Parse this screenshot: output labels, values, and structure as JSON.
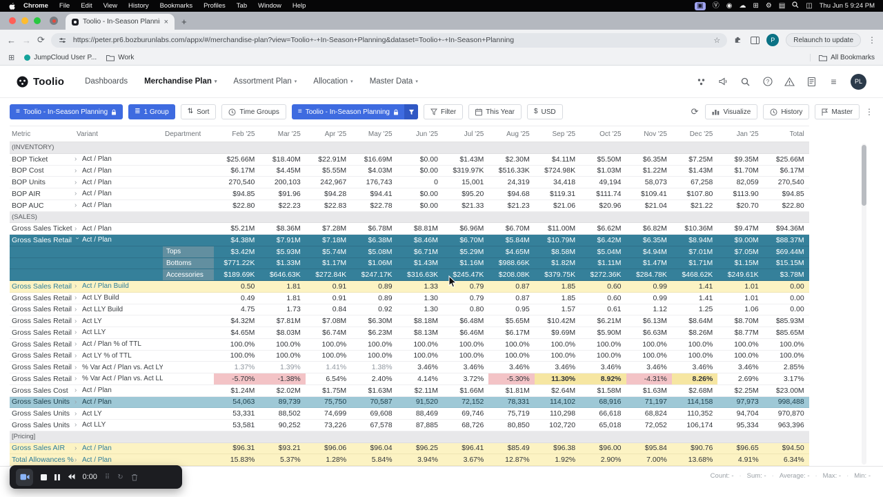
{
  "window": {
    "clock": "Thu Jun 5 9:24 PM",
    "menu_items": [
      "Chrome",
      "File",
      "Edit",
      "View",
      "History",
      "Bookmarks",
      "Profiles",
      "Tab",
      "Window",
      "Help"
    ]
  },
  "browser": {
    "tab_title": "Toolio - In-Season Planning",
    "url": "https://peter.pr6.bozburunlabs.com/appx/#/merchandise-plan?view=Toolio+-+In-Season+Planning&dataset=Toolio+-+In-Season+Planning",
    "relaunch_label": "Relaunch to update",
    "bookmarks": [
      "JumpCloud User P...",
      "Work"
    ],
    "all_bookmarks_label": "All Bookmarks"
  },
  "header": {
    "logo": "Toolio",
    "nav": [
      {
        "label": "Dashboards",
        "caret": false,
        "active": false
      },
      {
        "label": "Merchandise Plan",
        "caret": true,
        "active": true
      },
      {
        "label": "Assortment Plan",
        "caret": true,
        "active": false
      },
      {
        "label": "Allocation",
        "caret": true,
        "active": false
      },
      {
        "label": "Master Data",
        "caret": true,
        "active": false
      }
    ],
    "avatar": "PL"
  },
  "toolbar": {
    "view_name": "Toolio - In-Season Planning",
    "group_label": "1 Group",
    "sort_label": "Sort",
    "time_groups_label": "Time Groups",
    "filter_label": "Filter",
    "this_year_label": "This Year",
    "currency_label": "USD",
    "visualize_label": "Visualize",
    "history_label": "History",
    "master_label": "Master"
  },
  "table": {
    "columns": [
      "Metric",
      "Variant",
      "Department",
      "Feb '25",
      "Mar '25",
      "Apr '25",
      "May '25",
      "Jun '25",
      "Jul '25",
      "Aug '25",
      "Sep '25",
      "Oct '25",
      "Nov '25",
      "Dec '25",
      "Jan '25",
      "Total"
    ],
    "rows": [
      {
        "type": "section",
        "label": "(INVENTORY)"
      },
      {
        "type": "data",
        "metric": "BOP Ticket",
        "variant": "Act / Plan",
        "department": "",
        "style": "",
        "values": [
          "$25.66M",
          "$18.40M",
          "$22.91M",
          "$16.69M",
          "$0.00",
          "$1.43M",
          "$2.30M",
          "$4.11M",
          "$5.50M",
          "$6.35M",
          "$7.25M",
          "$9.35M",
          "$25.66M"
        ]
      },
      {
        "type": "data",
        "metric": "BOP Cost",
        "variant": "Act / Plan",
        "department": "",
        "style": "",
        "values": [
          "$6.17M",
          "$4.45M",
          "$5.55M",
          "$4.03M",
          "$0.00",
          "$319.97K",
          "$516.33K",
          "$724.98K",
          "$1.03M",
          "$1.22M",
          "$1.43M",
          "$1.70M",
          "$6.17M"
        ]
      },
      {
        "type": "data",
        "metric": "BOP Units",
        "variant": "Act / Plan",
        "department": "",
        "style": "",
        "values": [
          "270,540",
          "200,103",
          "242,967",
          "176,743",
          "0",
          "15,001",
          "24,319",
          "34,418",
          "49,194",
          "58,073",
          "67,258",
          "82,059",
          "270,540"
        ]
      },
      {
        "type": "data",
        "metric": "BOP AIR",
        "variant": "Act / Plan",
        "department": "",
        "style": "",
        "values": [
          "$94.85",
          "$91.96",
          "$94.28",
          "$94.41",
          "$0.00",
          "$95.20",
          "$94.68",
          "$119.31",
          "$111.74",
          "$109.41",
          "$107.80",
          "$113.90",
          "$94.85"
        ]
      },
      {
        "type": "data",
        "metric": "BOP AUC",
        "variant": "Act / Plan",
        "department": "",
        "style": "",
        "values": [
          "$22.80",
          "$22.23",
          "$22.83",
          "$22.78",
          "$0.00",
          "$21.33",
          "$21.23",
          "$21.06",
          "$20.96",
          "$21.04",
          "$21.22",
          "$20.70",
          "$22.80"
        ]
      },
      {
        "type": "section",
        "label": "(SALES)"
      },
      {
        "type": "data",
        "metric": "Gross Sales Ticket",
        "variant": "Act / Plan",
        "department": "",
        "style": "",
        "values": [
          "$5.21M",
          "$8.36M",
          "$7.28M",
          "$6.78M",
          "$8.81M",
          "$6.96M",
          "$6.70M",
          "$11.00M",
          "$6.62M",
          "$6.82M",
          "$10.36M",
          "$9.47M",
          "$94.36M"
        ]
      },
      {
        "type": "data",
        "metric": "Gross Sales Retail",
        "variant": "Act / Plan",
        "department": "",
        "style": "selected",
        "expanded": true,
        "values": [
          "$4.38M",
          "$7.91M",
          "$7.18M",
          "$6.38M",
          "$8.46M",
          "$6.70M",
          "$5.84M",
          "$10.79M",
          "$6.42M",
          "$6.35M",
          "$8.94M",
          "$9.00M",
          "$88.37M"
        ]
      },
      {
        "type": "data",
        "metric": "",
        "variant": "",
        "department": "Tops",
        "style": "sub",
        "values": [
          "$3.42M",
          "$5.93M",
          "$5.74M",
          "$5.08M",
          "$6.71M",
          "$5.29M",
          "$4.65M",
          "$8.58M",
          "$5.04M",
          "$4.94M",
          "$7.01M",
          "$7.05M",
          "$69.44M"
        ]
      },
      {
        "type": "data",
        "metric": "",
        "variant": "",
        "department": "Bottoms",
        "style": "sub",
        "values": [
          "$771.22K",
          "$1.33M",
          "$1.17M",
          "$1.06M",
          "$1.43M",
          "$1.16M",
          "$988.66K",
          "$1.82M",
          "$1.11M",
          "$1.47M",
          "$1.71M",
          "$1.15M",
          "$15.15M"
        ]
      },
      {
        "type": "data",
        "metric": "",
        "variant": "",
        "department": "Accessories",
        "style": "sub",
        "values": [
          "$189.69K",
          "$646.63K",
          "$272.84K",
          "$247.17K",
          "$316.63K",
          "$245.47K",
          "$208.08K",
          "$379.75K",
          "$272.36K",
          "$284.78K",
          "$468.62K",
          "$249.61K",
          "$3.78M"
        ]
      },
      {
        "type": "data",
        "metric": "Gross Sales Retail",
        "variant": "Act / Plan Build",
        "department": "",
        "style": "yellow",
        "values": [
          "0.50",
          "1.81",
          "0.91",
          "0.89",
          "1.33",
          "0.79",
          "0.87",
          "1.85",
          "0.60",
          "0.99",
          "1.41",
          "1.01",
          "0.00"
        ]
      },
      {
        "type": "data",
        "metric": "Gross Sales Retail",
        "variant": "Act LY Build",
        "department": "",
        "style": "",
        "values": [
          "0.49",
          "1.81",
          "0.91",
          "0.89",
          "1.30",
          "0.79",
          "0.87",
          "1.85",
          "0.60",
          "0.99",
          "1.41",
          "1.01",
          "0.00"
        ]
      },
      {
        "type": "data",
        "metric": "Gross Sales Retail",
        "variant": "Act LLY Build",
        "department": "",
        "style": "",
        "values": [
          "4.75",
          "1.73",
          "0.84",
          "0.92",
          "1.30",
          "0.80",
          "0.95",
          "1.57",
          "0.61",
          "1.12",
          "1.25",
          "1.06",
          "0.00"
        ]
      },
      {
        "type": "data",
        "metric": "Gross Sales Retail",
        "variant": "Act LY",
        "department": "",
        "style": "",
        "values": [
          "$4.32M",
          "$7.81M",
          "$7.08M",
          "$6.30M",
          "$8.18M",
          "$6.48M",
          "$5.65M",
          "$10.42M",
          "$6.21M",
          "$6.13M",
          "$8.64M",
          "$8.70M",
          "$85.93M"
        ]
      },
      {
        "type": "data",
        "metric": "Gross Sales Retail",
        "variant": "Act LLY",
        "department": "",
        "style": "",
        "values": [
          "$4.65M",
          "$8.03M",
          "$6.74M",
          "$6.23M",
          "$8.13M",
          "$6.46M",
          "$6.17M",
          "$9.69M",
          "$5.90M",
          "$6.63M",
          "$8.26M",
          "$8.77M",
          "$85.65M"
        ]
      },
      {
        "type": "data",
        "metric": "Gross Sales Retail",
        "variant": "Act / Plan % of TTL",
        "department": "",
        "style": "",
        "values": [
          "100.0%",
          "100.0%",
          "100.0%",
          "100.0%",
          "100.0%",
          "100.0%",
          "100.0%",
          "100.0%",
          "100.0%",
          "100.0%",
          "100.0%",
          "100.0%",
          "100.0%"
        ]
      },
      {
        "type": "data",
        "metric": "Gross Sales Retail",
        "variant": "Act LY % of TTL",
        "department": "",
        "style": "",
        "values": [
          "100.0%",
          "100.0%",
          "100.0%",
          "100.0%",
          "100.0%",
          "100.0%",
          "100.0%",
          "100.0%",
          "100.0%",
          "100.0%",
          "100.0%",
          "100.0%",
          "100.0%"
        ]
      },
      {
        "type": "data",
        "metric": "Gross Sales Retail",
        "variant": "% Var Act / Plan vs. Act LY",
        "department": "",
        "style": "",
        "cell_styles": [
          "dim",
          "dim",
          "dim",
          "dim",
          "",
          "",
          "",
          "",
          "",
          "",
          "",
          "",
          ""
        ],
        "values": [
          "1.37%",
          "1.39%",
          "1.41%",
          "1.38%",
          "3.46%",
          "3.46%",
          "3.46%",
          "3.46%",
          "3.46%",
          "3.46%",
          "3.46%",
          "3.46%",
          "2.85%"
        ]
      },
      {
        "type": "data",
        "metric": "Gross Sales Retail",
        "variant": "% Var Act / Plan vs. Act LLY",
        "department": "",
        "style": "",
        "cell_styles": [
          "neg",
          "neg",
          "",
          "",
          "",
          "",
          "neg",
          "hl",
          "hl",
          "neg",
          "hl",
          "",
          ""
        ],
        "values": [
          "-5.70%",
          "-1.38%",
          "6.54%",
          "2.40%",
          "4.14%",
          "3.72%",
          "-5.30%",
          "11.30%",
          "8.92%",
          "-4.31%",
          "8.26%",
          "2.69%",
          "3.17%"
        ]
      },
      {
        "type": "data",
        "metric": "Gross Sales Cost",
        "variant": "Act / Plan",
        "department": "",
        "style": "",
        "values": [
          "$1.24M",
          "$2.02M",
          "$1.75M",
          "$1.63M",
          "$2.11M",
          "$1.66M",
          "$1.81M",
          "$2.64M",
          "$1.58M",
          "$1.63M",
          "$2.68M",
          "$2.25M",
          "$23.00M"
        ]
      },
      {
        "type": "data",
        "metric": "Gross Sales Units",
        "variant": "Act / Plan",
        "department": "",
        "style": "teal-light",
        "values": [
          "54,063",
          "89,739",
          "75,750",
          "70,587",
          "91,520",
          "72,152",
          "78,331",
          "114,102",
          "68,916",
          "71,197",
          "114,158",
          "97,973",
          "998,488"
        ]
      },
      {
        "type": "data",
        "metric": "Gross Sales Units",
        "variant": "Act LY",
        "department": "",
        "style": "",
        "values": [
          "53,331",
          "88,502",
          "74,699",
          "69,608",
          "88,469",
          "69,746",
          "75,719",
          "110,298",
          "66,618",
          "68,824",
          "110,352",
          "94,704",
          "970,870"
        ]
      },
      {
        "type": "data",
        "metric": "Gross Sales Units",
        "variant": "Act LLY",
        "department": "",
        "style": "",
        "values": [
          "53,581",
          "90,252",
          "73,226",
          "67,578",
          "87,885",
          "68,726",
          "80,850",
          "102,720",
          "65,018",
          "72,052",
          "106,174",
          "95,334",
          "963,396"
        ]
      },
      {
        "type": "section",
        "label": "[Pricing]"
      },
      {
        "type": "data",
        "metric": "Gross Sales AIR",
        "variant": "Act / Plan",
        "department": "",
        "style": "yellow",
        "values": [
          "$96.31",
          "$93.21",
          "$96.06",
          "$96.04",
          "$96.25",
          "$96.41",
          "$85.49",
          "$96.38",
          "$96.00",
          "$95.84",
          "$90.76",
          "$96.65",
          "$94.50"
        ]
      },
      {
        "type": "data",
        "metric": "Total Allowances %",
        "variant": "Act / Plan",
        "department": "",
        "style": "yellow",
        "values": [
          "15.83%",
          "5.37%",
          "1.28%",
          "5.84%",
          "3.94%",
          "3.67%",
          "12.87%",
          "1.92%",
          "2.90%",
          "7.00%",
          "13.68%",
          "4.91%",
          "6.34%"
        ]
      }
    ]
  },
  "recorder": {
    "time": "0:00"
  },
  "status_stats": [
    {
      "label": "Count:",
      "value": "-"
    },
    {
      "label": "Sum:",
      "value": "-"
    },
    {
      "label": "Average:",
      "value": "-"
    },
    {
      "label": "Max:",
      "value": "-"
    },
    {
      "label": "Min:",
      "value": "-"
    }
  ],
  "colors": {
    "accent_blue": "#3E6BE0",
    "selected_teal": "#35809A",
    "subrow_dept_teal": "#628FA0",
    "editable_yellow": "#FCF3C3",
    "light_teal_row": "#9EC8D6",
    "negative_pink": "#F3C3C6",
    "highlight_amber": "#F6E6A2"
  }
}
